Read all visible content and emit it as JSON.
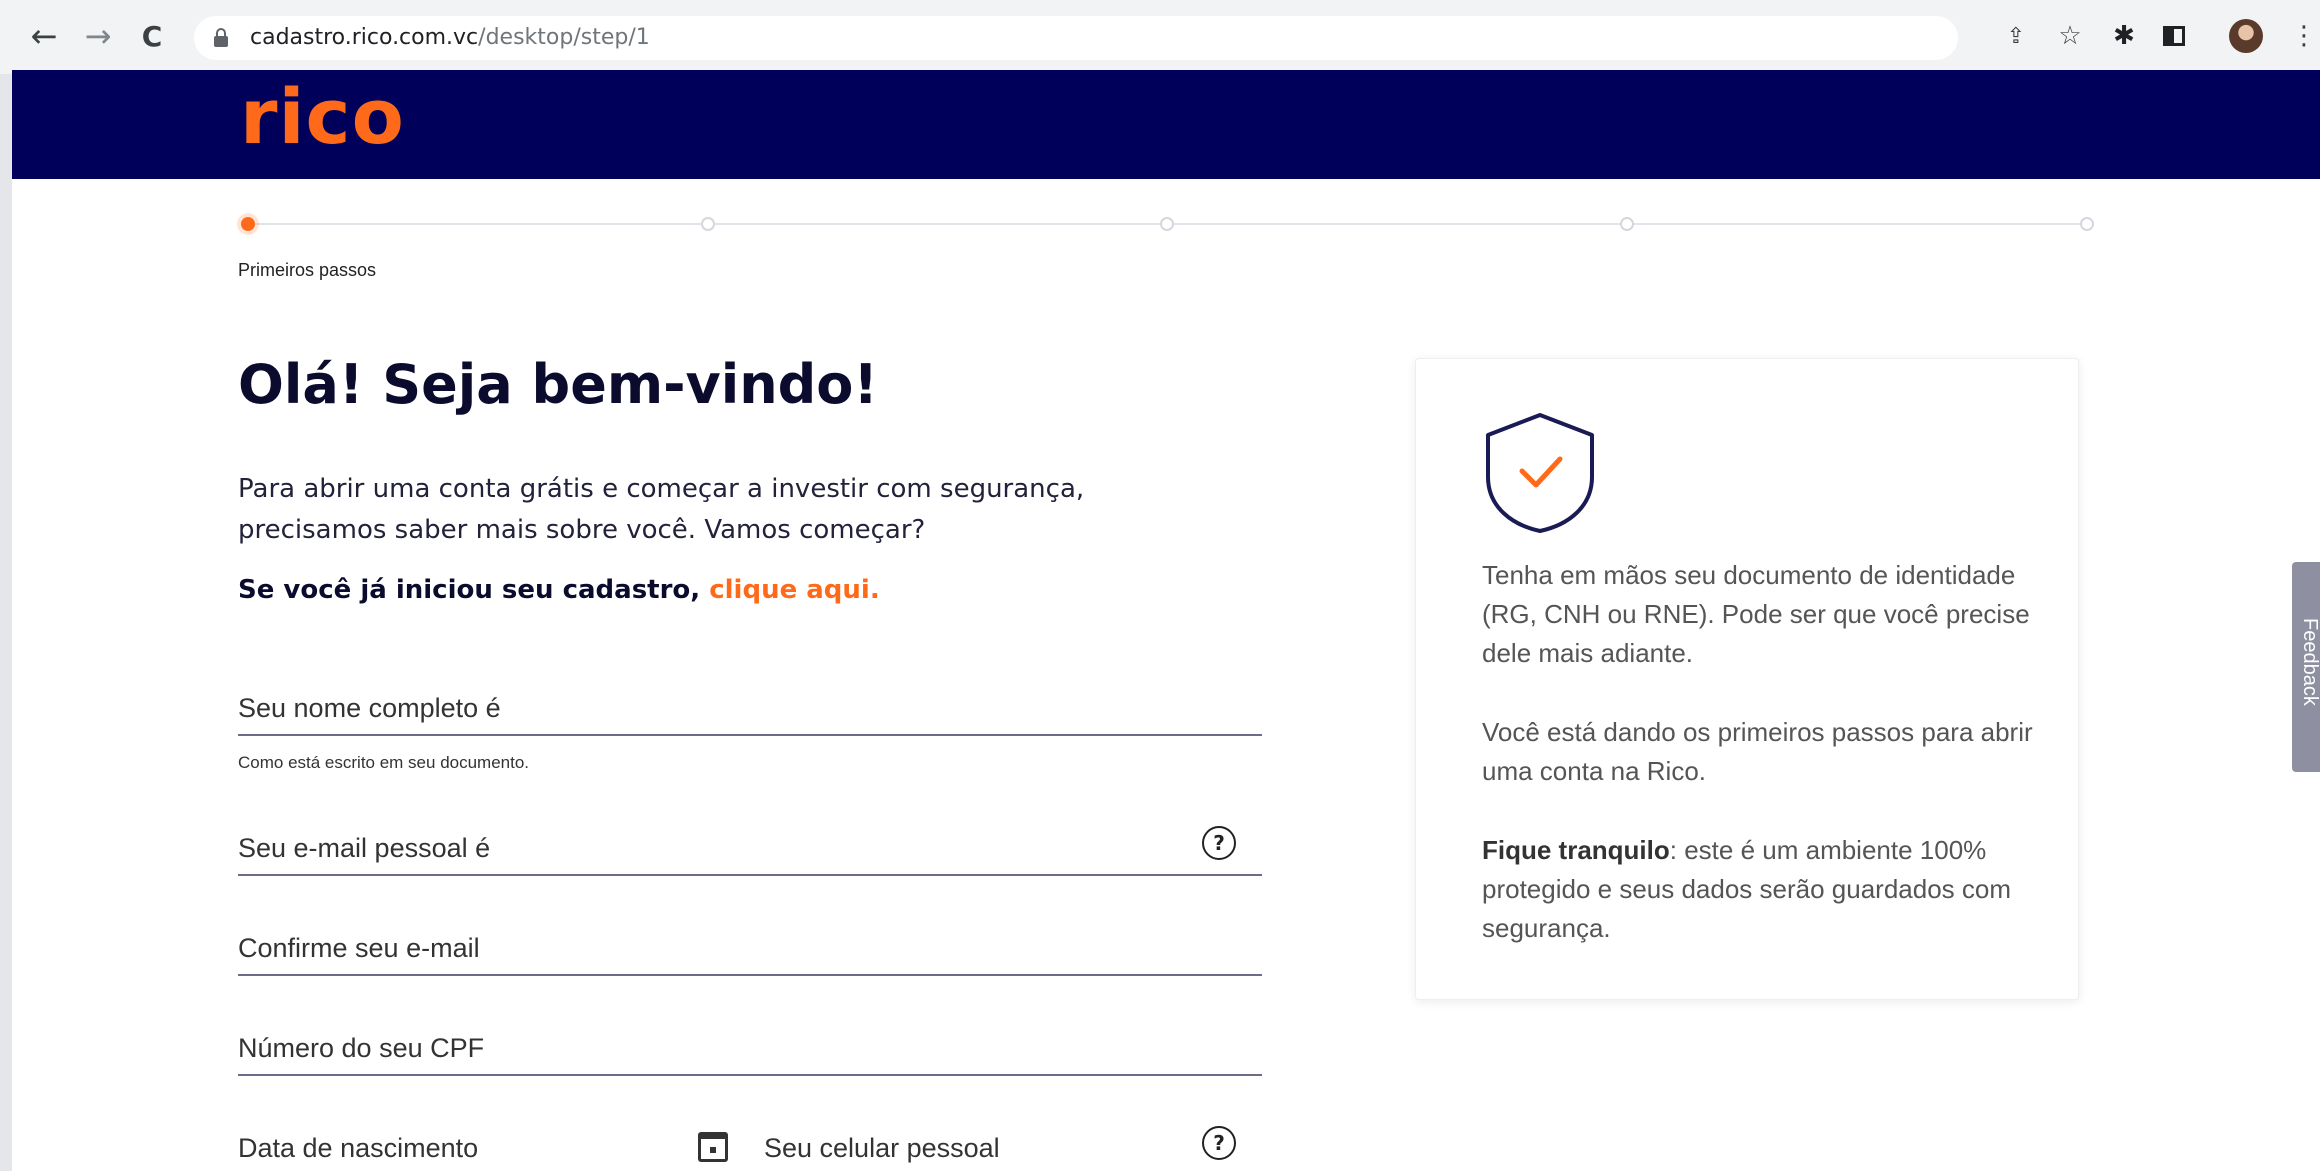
{
  "browser": {
    "url_host": "cadastro.rico.com.vc",
    "url_path": "/desktop/step/1"
  },
  "site": {
    "logo_text": "rico",
    "brand_color": "#ff6a1a",
    "header_color": "#00005a"
  },
  "stepper": {
    "steps": 5,
    "current_step": 1,
    "current_label": "Primeiros passos"
  },
  "main": {
    "title": "Olá! Seja bem-vindo!",
    "intro": "Para abrir uma conta grátis e começar a investir com segurança, precisamos saber mais sobre você. Vamos começar?",
    "resume_prefix": "Se você já iniciou seu cadastro, ",
    "resume_link": "clique aqui."
  },
  "form": {
    "name_placeholder": "Seu nome completo é",
    "name_hint": "Como está escrito em seu documento.",
    "email_placeholder": "Seu e-mail pessoal é",
    "confirm_email_placeholder": "Confirme seu e-mail",
    "cpf_placeholder": "Número do seu CPF",
    "birth_placeholder": "Data de nascimento",
    "phone_placeholder": "Seu celular pessoal",
    "help_glyph": "?"
  },
  "info_card": {
    "p1": "Tenha em mãos seu documento de identidade (RG, CNH ou RNE). Pode ser que você precise dele mais adiante.",
    "p2": "Você está dando os primeiros passos para abrir uma conta na Rico.",
    "p3_bold": "Fique tranquilo",
    "p3_rest": ": este é um ambiente 100% protegido e seus dados serão guardados com segurança."
  },
  "feedback_tab": "Feedback"
}
